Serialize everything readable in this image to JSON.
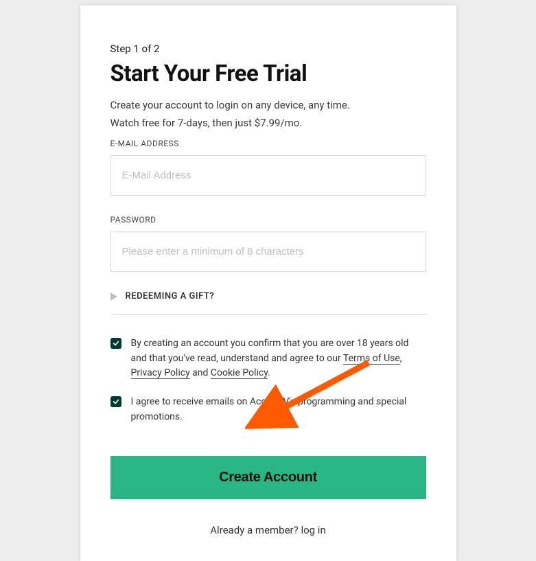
{
  "step": "Step 1 of 2",
  "title": "Start Your Free Trial",
  "desc_line1": "Create your account to login on any device, any time.",
  "desc_line2": "Watch free for 7-days, then just $7.99/mo.",
  "email": {
    "label": "E-MAIL ADDRESS",
    "placeholder": "E-Mail Address"
  },
  "password": {
    "label": "PASSWORD",
    "placeholder": "Please enter a minimum of 8 characters"
  },
  "redeem": "REDEEMING A GIFT?",
  "terms": {
    "prefix": "By creating an account you confirm that you are over 18 years old and that you've read, understand and agree to our ",
    "terms_of_use": "Terms of Use",
    "sep1": ", ",
    "privacy_policy": "Privacy Policy",
    "sep2": " and ",
    "cookie_policy": "Cookie Policy",
    "suffix": "."
  },
  "marketing": "I agree to receive emails on Acorn TV's programming and special promotions.",
  "submit": "Create Account",
  "login_prompt": "Already a member? ",
  "login_link": "log in"
}
